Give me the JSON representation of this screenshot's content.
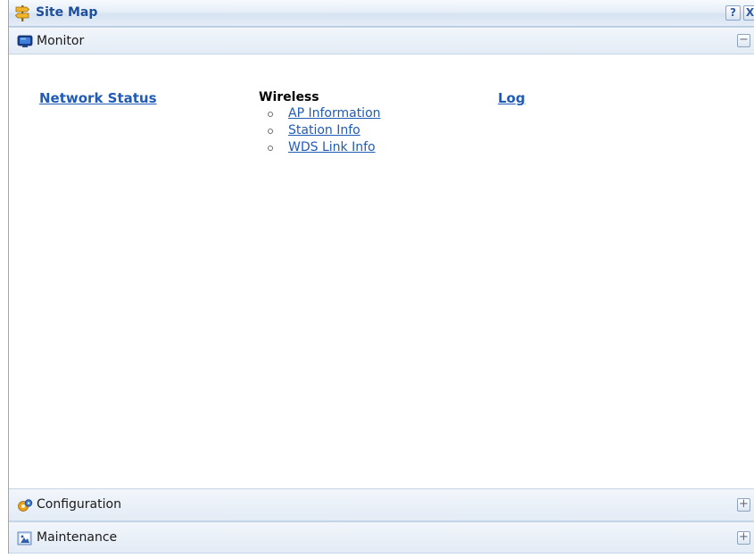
{
  "window": {
    "title": "Site Map",
    "help_label": "?",
    "close_label": "X"
  },
  "sections": {
    "monitor": {
      "label": "Monitor",
      "toggle": "−",
      "columns": {
        "network_status": {
          "label": "Network Status"
        },
        "wireless": {
          "heading": "Wireless",
          "items": [
            {
              "label": "AP Information"
            },
            {
              "label": "Station Info"
            },
            {
              "label": "WDS Link Info"
            }
          ]
        },
        "log": {
          "label": "Log"
        }
      }
    },
    "configuration": {
      "label": "Configuration",
      "toggle": "+"
    },
    "maintenance": {
      "label": "Maintenance",
      "toggle": "+"
    }
  },
  "colors": {
    "title_text": "#1e4f9e",
    "link": "#1f5bb7",
    "header_bg": "#e3ebf5",
    "border": "#c5d5e8"
  },
  "icons": {
    "title": "signpost-icon",
    "monitor": "monitor-icon",
    "configuration": "gears-icon",
    "maintenance": "maintenance-icon"
  }
}
